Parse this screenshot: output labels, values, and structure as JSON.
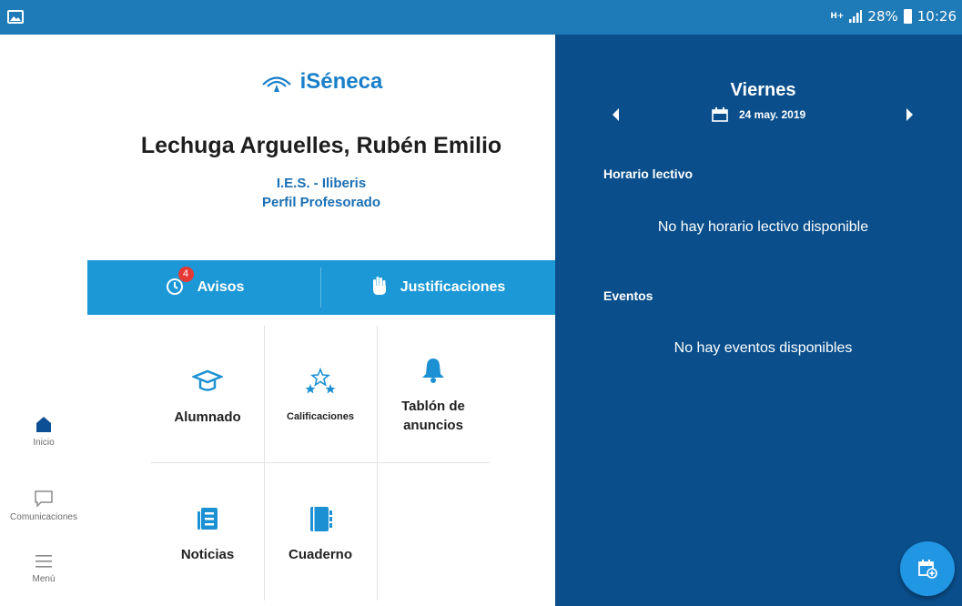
{
  "status_bar": {
    "network": "H+",
    "battery": "28%",
    "time": "10:26"
  },
  "rail": {
    "items": [
      {
        "label": "Inicio",
        "icon": "home-icon"
      },
      {
        "label": "Comunicaciones",
        "icon": "chat-icon"
      },
      {
        "label": "Menú",
        "icon": "menu-icon"
      }
    ]
  },
  "header": {
    "logo_text": "iSéneca",
    "user_name": "Lechuga Arguelles, Rubén Emilio",
    "school": "I.E.S. - Iliberis",
    "profile": "Perfil Profesorado"
  },
  "tabs": {
    "avisos": {
      "label": "Avisos",
      "badge": "4"
    },
    "justificaciones": {
      "label": "Justificaciones"
    }
  },
  "grid": [
    {
      "label": "Alumnado",
      "icon": "graduation-cap-icon"
    },
    {
      "label": "Calificaciones",
      "icon": "stars-icon"
    },
    {
      "label": "Tablón de anuncios",
      "icon": "bell-icon"
    },
    {
      "label": "Noticias",
      "icon": "news-icon"
    },
    {
      "label": "Cuaderno",
      "icon": "notebook-icon"
    }
  ],
  "agenda": {
    "day": "Viernes",
    "date": "24 may. 2019",
    "horario_title": "Horario lectivo",
    "horario_empty": "No hay horario lectivo disponible",
    "eventos_title": "Eventos",
    "eventos_empty": "No hay eventos disponibles"
  },
  "colors": {
    "status_bar": "#1f7ab8",
    "tab_bar": "#1c98d6",
    "side_panel": "#0a4f8c",
    "accent": "#1a7fc9",
    "fab": "#2196e3",
    "badge": "#e53935"
  }
}
